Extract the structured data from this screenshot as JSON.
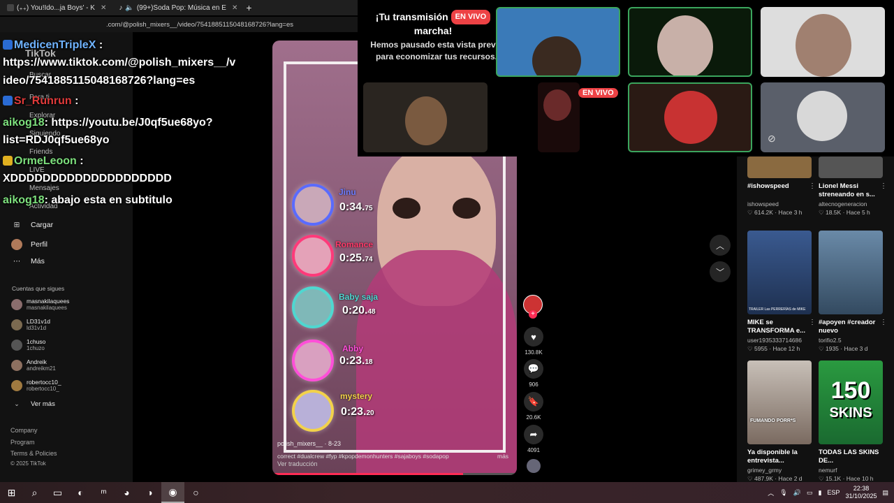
{
  "browser": {
    "tabs": [
      {
        "label": "(₊₊) You!Ido...ja Boys' - K"
      },
      {
        "label": "(99+)Soda Pop: Música en E"
      }
    ],
    "url": ".com/@polish_mixers__/video/7541885115048168726?lang=es"
  },
  "sidebar": {
    "links": [
      "TikTok",
      "Buscar",
      "Para ti",
      "Explorar",
      "Siguiendo",
      "Friends",
      "LIVE",
      "Mensajes",
      "Actividad"
    ],
    "items": [
      {
        "label": "Cargar",
        "icon": "plus-square-icon"
      },
      {
        "label": "Perfil",
        "icon": "avatar"
      },
      {
        "label": "Más",
        "icon": "more-dots-icon"
      }
    ],
    "following_header": "Cuentas que sigues",
    "following": [
      {
        "name": "masnakilaquees",
        "handle": "masnakilaquees"
      },
      {
        "name": "LD31v1d",
        "handle": "ld31v1d"
      },
      {
        "name": "1chuso",
        "handle": "1chuzo"
      },
      {
        "name": "Andreik",
        "handle": "andreikm21"
      },
      {
        "name": "robertocc10_",
        "handle": "robertocc10_"
      }
    ],
    "see_more": "Ver más",
    "footer": [
      "Company",
      "Program",
      "Terms & Policies",
      "© 2025 TikTok"
    ]
  },
  "chat": {
    "lines": [
      {
        "user": "MedicenTripleX",
        "msg": ":"
      },
      {
        "user": "",
        "msg": "https://www.tiktok.com/@polish_mixers__/v"
      },
      {
        "user": "",
        "msg": "ideo/7541885115048168726?lang=es"
      },
      {
        "user": "Sr_Runrun",
        "msg": ":"
      },
      {
        "user": "aikog18",
        "msg": ": https://youtu.be/J0qf5ue68yo?"
      },
      {
        "user": "",
        "msg": "list=RDJ0qf5ue68yo"
      },
      {
        "user": "OrmeLeoon",
        "msg": ":"
      },
      {
        "user": "",
        "msg": "XDDDDDDDDDDDDDDDDDDDD"
      },
      {
        "user": "aikog18",
        "msg": ": abajo esta en subtitulo"
      }
    ]
  },
  "video": {
    "rows": [
      {
        "name": "Jinu",
        "time": "0:34.",
        "ms": "75",
        "color": "#6f7dff"
      },
      {
        "name": "Romance",
        "time": "0:25.",
        "ms": "74",
        "color": "#ff3a6a"
      },
      {
        "name": "Baby saja",
        "time": "0:20.",
        "ms": "48",
        "color": "#4fd7d0"
      },
      {
        "name": "Abby",
        "time": "0:23.",
        "ms": "18",
        "color": "#ff4fd8"
      },
      {
        "name": "mystery",
        "time": "0:23.",
        "ms": "20",
        "color": "#f2d24a"
      }
    ],
    "author": "polish_mixers__ · 8-23",
    "description": "correct #dualcrew #fyp #kpopdemonhunters #sajaboys #sodapop",
    "more": "más",
    "translate": "Ver traducción",
    "progress": 0.78
  },
  "actions": {
    "likes": "130.8K",
    "comments": "906",
    "saves": "20.6K",
    "shares": "4091"
  },
  "discord": {
    "title": "¡Tu transmisión",
    "title2": "marcha!",
    "live": "EN VIVO",
    "subtitle": "Hemos pausado esta vista previa para economizar tus recursos."
  },
  "recs": [
    {
      "title": "#ishowspeed",
      "user": "ishowspeed",
      "likes": "614.2K",
      "time": "Hace 3 h"
    },
    {
      "title": "Lionel Messi streneando en s...",
      "user": "altecnogeneracion",
      "likes": "18.5K",
      "time": "Hace 5 h"
    },
    {
      "title": "MIKE se TRANSFORMA e...",
      "user": "user1935333714686",
      "likes": "5955",
      "time": "Hace 12 h"
    },
    {
      "title": "#apoyen #creador nuevo",
      "user": "torifio2.5",
      "likes": "1935",
      "time": "Hace 3 d"
    },
    {
      "title": "Ya disponible la entrevista...",
      "user": "grimey_grmy",
      "likes": "487.9K",
      "time": "Hace 2 d"
    },
    {
      "title": "TODAS LAS SKINS DE...",
      "user": "nemurf",
      "likes": "15.1K",
      "time": "Hace 10 h"
    }
  ],
  "thumb_text": {
    "trailer": "TRAILER Las PERRERÍAS de MIKE",
    "fumando": "FUMANDO PORR*S",
    "skins_num": "150",
    "skins_word": "SKINS"
  },
  "taskbar": {
    "lang": "ESP",
    "time": "22:38",
    "date": "31/10/2025"
  }
}
